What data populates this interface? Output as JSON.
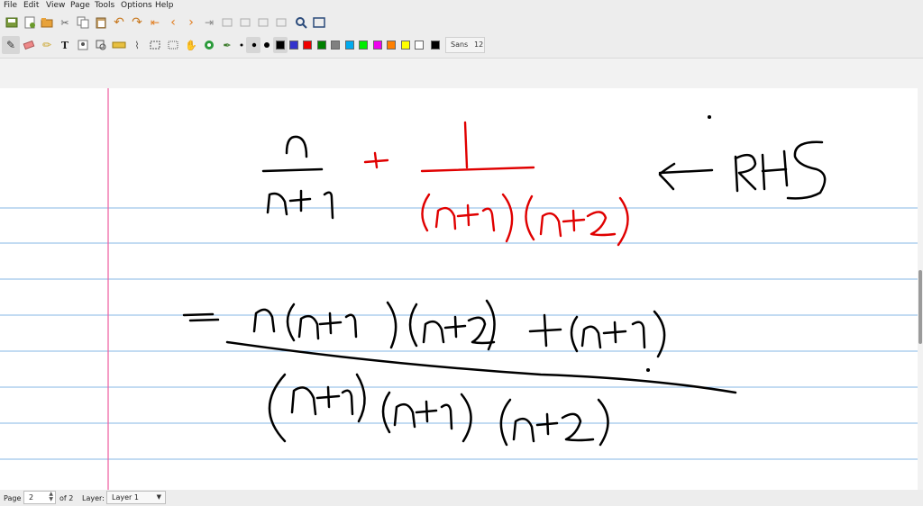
{
  "menu": [
    "File",
    "Edit",
    "View",
    "Page",
    "Tools",
    "Options",
    "Help"
  ],
  "toolbar": {
    "font_name": "Sans",
    "font_size": "12",
    "colors": {
      "black": "#000000",
      "blue": "#3333cc",
      "red": "#ee0000",
      "green": "#008000",
      "gray": "#808080",
      "cyan": "#00aaee",
      "lime": "#00ee00",
      "magenta": "#ee00ee",
      "orange": "#ff8000",
      "yellow": "#ffff00",
      "white": "#ffffff",
      "black_active": "#000000"
    }
  },
  "paper": {
    "ruling_color": "#86b7e5",
    "margin_color": "#ee5a9e",
    "ink_black": "#000000",
    "ink_red": "#e00000"
  },
  "status": {
    "page_label": "Page",
    "page_value": "2",
    "page_total": "of 2",
    "layer_label": "Layer:",
    "layer_value": "Layer 1"
  }
}
